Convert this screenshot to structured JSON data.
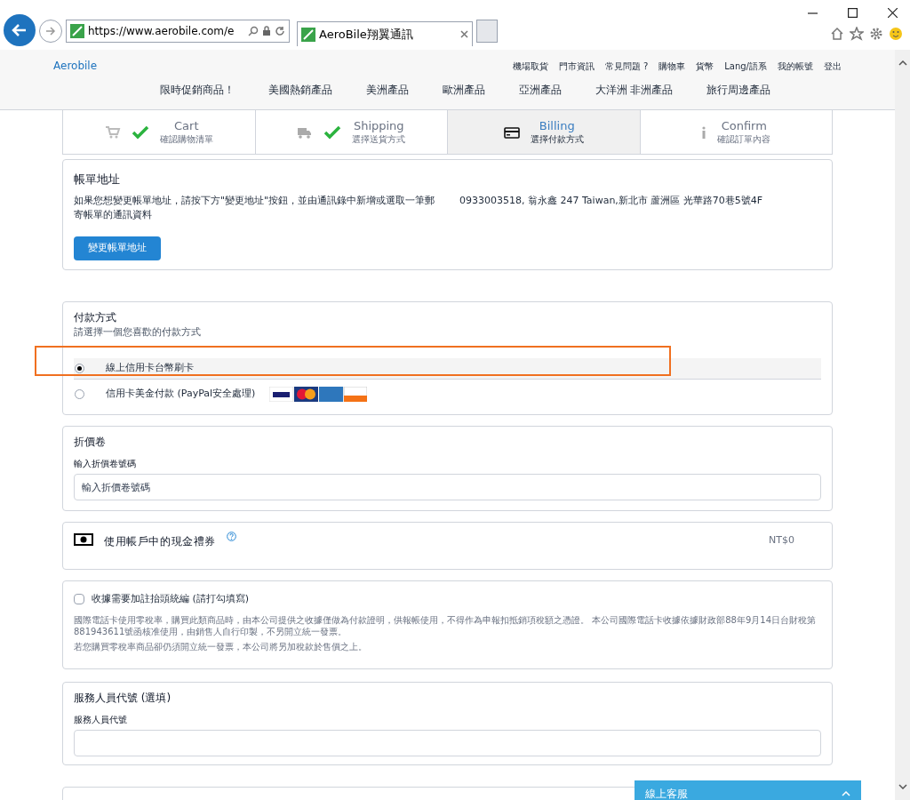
{
  "browser": {
    "url": "https://www.aerobile.com/e",
    "tab_title": "AeroBile翔翼通訊"
  },
  "header": {
    "logo": "Aerobile",
    "top_links": [
      "機場取貨",
      "門市資訊",
      "常見問題 ?",
      "購物車",
      "貨幣",
      "Lang/語系",
      "我的帳號",
      "登出"
    ],
    "nav": [
      "限時促銷商品！",
      "美國熱銷產品",
      "美洲產品",
      "歐洲產品",
      "亞洲產品",
      "大洋洲 非洲產品",
      "旅行周邊產品"
    ]
  },
  "steps": [
    {
      "kind": "cart",
      "title": "Cart",
      "subtitle": "確認購物清單",
      "done": true,
      "selected": false
    },
    {
      "kind": "shipping",
      "title": "Shipping",
      "subtitle": "選擇送貨方式",
      "done": true,
      "selected": false
    },
    {
      "kind": "billing",
      "title": "Billing",
      "subtitle": "選擇付款方式",
      "done": false,
      "selected": true
    },
    {
      "kind": "confirm",
      "title": "Confirm",
      "subtitle": "確認訂單內容",
      "done": false,
      "selected": false
    }
  ],
  "billing_address": {
    "title": "帳單地址",
    "note": "如果您想變更帳單地址，請按下方\"變更地址\"按鈕，並由通訊錄中新增或選取一筆郵寄帳單的通訊資料",
    "address": "0933003518, 翁永鑫 247 Taiwan,新北市 蘆洲區 光華路70巷5號4F",
    "button": "變更帳單地址"
  },
  "payment": {
    "title": "付款方式",
    "subtitle": "請選擇一個您喜歡的付款方式",
    "options": [
      {
        "label": "線上信用卡台幣刷卡",
        "selected": true,
        "highlighted": true,
        "cards": false
      },
      {
        "label": "信用卡美金付款 (PayPal安全處理)",
        "selected": false,
        "highlighted": false,
        "cards": true
      }
    ]
  },
  "coupon": {
    "title": "折價卷",
    "label": "輸入折價卷號碼",
    "placeholder": "輸入折價卷號碼"
  },
  "gift_voucher": {
    "title": "使用帳戶中的現金禮券",
    "amount": "NT$0"
  },
  "receipt": {
    "label": "收據需要加註抬頭統編 (請打勾填寫)",
    "checked": false,
    "notes": [
      "國際電話卡使用零稅率，購買此類商品時，由本公司提供之收據僅做為付款證明，供報帳使用，不得作為申報扣抵銷項稅額之憑證。 本公司國際電話卡收據依據財政部88年9月14日台財稅第881943611號函核准使用，由銷售人自行印製，不另開立統一發票。",
      "若您購買零稅率商品卻仍須開立統一發票，本公司將另加稅款於售價之上。"
    ]
  },
  "staff_code": {
    "title": "服務人員代號 (選填)",
    "label": "服務人員代號"
  },
  "chat": {
    "label": "線上客服"
  }
}
